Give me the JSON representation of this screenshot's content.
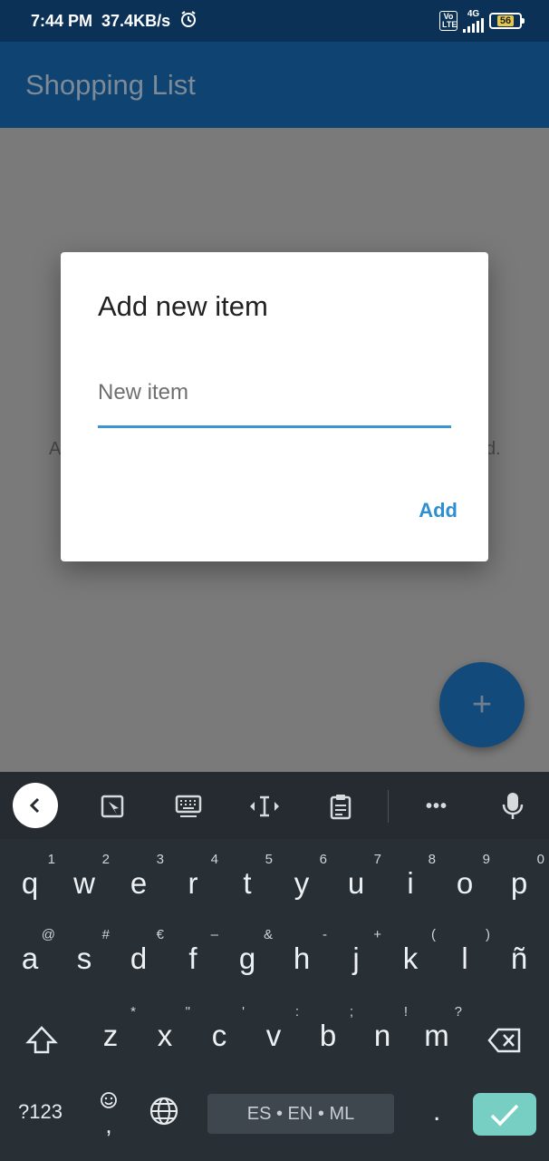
{
  "status_bar": {
    "time": "7:44 PM",
    "speed": "37.4KB/s",
    "volte": "Vo LTE",
    "network": "4G",
    "battery": "56"
  },
  "app_bar": {
    "title": "Shopping List"
  },
  "background": {
    "left_fragment": "A",
    "right_fragment": "d."
  },
  "dialog": {
    "title": "Add new item",
    "input_placeholder": "New item",
    "input_value": "",
    "add_label": "Add"
  },
  "fab": {
    "label": "+"
  },
  "keyboard": {
    "row1": [
      {
        "k": "q",
        "h": "1"
      },
      {
        "k": "w",
        "h": "2"
      },
      {
        "k": "e",
        "h": "3"
      },
      {
        "k": "r",
        "h": "4"
      },
      {
        "k": "t",
        "h": "5"
      },
      {
        "k": "y",
        "h": "6"
      },
      {
        "k": "u",
        "h": "7"
      },
      {
        "k": "i",
        "h": "8"
      },
      {
        "k": "o",
        "h": "9"
      },
      {
        "k": "p",
        "h": "0"
      }
    ],
    "row2": [
      {
        "k": "a",
        "h": "@"
      },
      {
        "k": "s",
        "h": "#"
      },
      {
        "k": "d",
        "h": "€"
      },
      {
        "k": "f",
        "h": "–"
      },
      {
        "k": "g",
        "h": "&"
      },
      {
        "k": "h",
        "h": "-"
      },
      {
        "k": "j",
        "h": "+"
      },
      {
        "k": "k",
        "h": "("
      },
      {
        "k": "l",
        "h": ")"
      },
      {
        "k": "ñ",
        "h": ""
      }
    ],
    "row3": [
      {
        "k": "z",
        "h": "*"
      },
      {
        "k": "x",
        "h": "\""
      },
      {
        "k": "c",
        "h": "'"
      },
      {
        "k": "v",
        "h": ":"
      },
      {
        "k": "b",
        "h": ";"
      },
      {
        "k": "n",
        "h": "!"
      },
      {
        "k": "m",
        "h": "?"
      }
    ],
    "symbols_label": "?123",
    "emoji_comma": ",",
    "space_label": "ES • EN • ML",
    "period": ".",
    "icons": {
      "toolbar": [
        "chevron-left-icon",
        "sticker-icon",
        "keyboard-icon",
        "text-cursor-icon",
        "clipboard-icon",
        "more-icon",
        "microphone-icon"
      ],
      "shift": "shift-icon",
      "backspace": "backspace-icon",
      "globe": "globe-icon",
      "enter": "check-icon"
    },
    "more_label": "•••"
  }
}
